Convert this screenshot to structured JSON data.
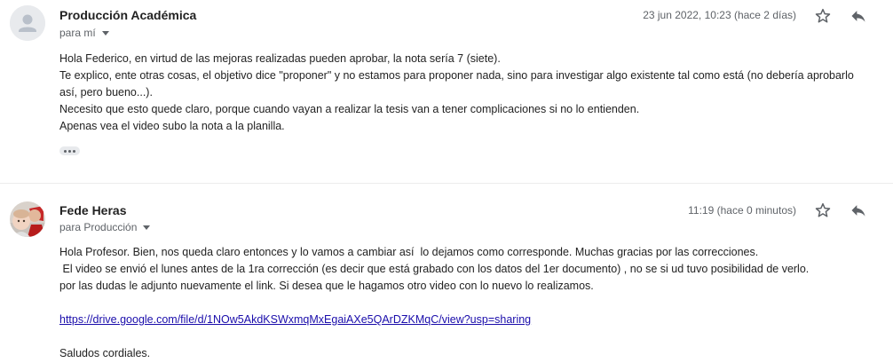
{
  "messages": [
    {
      "sender": "Producción Académica",
      "recipient": "para mí",
      "timestamp": "23 jun 2022, 10:23 (hace 2 días)",
      "avatar_icon": "default-person-icon",
      "body": [
        "Hola Federico, en virtud de las mejoras realizadas pueden aprobar, la nota sería 7 (siete).",
        "Te explico, ente otras cosas, el objetivo dice \"proponer\" y no estamos para proponer nada, sino para investigar algo existente tal como está (no debería aprobarlo",
        "así, pero bueno...).",
        "Necesito que esto quede claro, porque cuando vayan a realizar la tesis van a tener complicaciones si no lo entienden.",
        "Apenas vea el video subo la nota a la planilla."
      ]
    },
    {
      "sender": "Fede Heras",
      "recipient": "para Producción",
      "timestamp": "11:19 (hace 0 minutos)",
      "avatar_icon": "user-photo-avatar",
      "body_line1": "Hola Profesor. Bien, nos queda claro entonces y lo vamos a cambiar así  lo dejamos como corresponde. Muchas gracias por las correcciones.",
      "body_line2": " El video se envió el lunes antes de la 1ra corrección (es decir que está grabado con los datos del 1er documento) , no se si ud tuvo posibilidad de verlo.",
      "body_line3": "por las dudas le adjunto nuevamente el link. Si desea que le hagamos otro video con lo nuevo lo realizamos.",
      "link": "https://drive.google.com/file/d/1NOw5AkdKSWxmqMxEgaiAXe5QArDZKMqC/view?usp=sharing",
      "closing": "Saludos cordiales."
    }
  ],
  "icons": {
    "star": "star-icon",
    "reply": "reply-icon",
    "more": "more-vertical-icon",
    "expand": "ellipsis-icon"
  },
  "colors": {
    "link": "#1a0dab",
    "muted": "#5f6368"
  }
}
